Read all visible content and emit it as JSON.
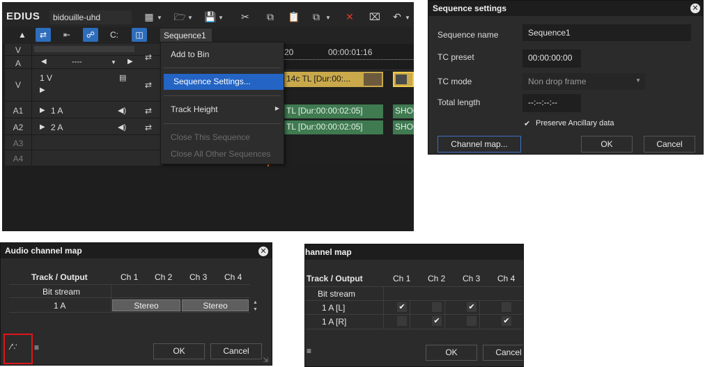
{
  "edius": {
    "logo": "EDIUS",
    "project_name": "bidouille-uhd",
    "sequence_tab": "Sequence1",
    "ruler": {
      "tc_left": "20",
      "tc_right": "00:00:01:16"
    },
    "tracks": {
      "v_label": "V",
      "a_label": "A",
      "a_value": "----",
      "v1_label": "V",
      "v1_name": "1 V",
      "a1_label": "A1",
      "a1_name": "1 A",
      "a2_label": "A2",
      "a2_name": "2 A",
      "a3_label": "A3",
      "a4_label": "A4"
    },
    "clips": {
      "video": "14c  TL [Dur:00:...",
      "a1": "TL [Dur:00:00:02:05]",
      "a2": "TL [Dur:00:00:02:05]",
      "shoot1": "SHOO",
      "shoot2": "SHOO"
    },
    "menu": {
      "add_to_bin": "Add to Bin",
      "sequence_settings": "Sequence Settings...",
      "track_height": "Track Height",
      "close_this": "Close This Sequence",
      "close_all_other": "Close All Other Sequences"
    }
  },
  "sequence_dialog": {
    "title": "Sequence settings",
    "name_label": "Sequence name",
    "name_value": "Sequence1",
    "tc_preset_label": "TC preset",
    "tc_preset_value": "00:00:00:00",
    "tc_mode_label": "TC mode",
    "tc_mode_value": "Non drop frame",
    "total_length_label": "Total length",
    "total_length_value": "--:--:--:--",
    "preserve_label": "Preserve Ancillary data",
    "channel_map_button": "Channel map...",
    "ok": "OK",
    "cancel": "Cancel"
  },
  "audio_map_left": {
    "title": "Audio channel map",
    "header_track": "Track / Output",
    "channels": [
      "Ch 1",
      "Ch 2",
      "Ch 3",
      "Ch 4"
    ],
    "bitstream": "Bit stream",
    "row_name": "1 A",
    "stereo1": "Stereo",
    "stereo2": "Stereo",
    "ok": "OK",
    "cancel": "Cancel"
  },
  "audio_map_right": {
    "title": "hannel map",
    "header_track": "Track / Output",
    "channels": [
      "Ch 1",
      "Ch 2",
      "Ch 3",
      "Ch 4"
    ],
    "bitstream": "Bit stream",
    "row1": "1 A [L]",
    "row2": "1 A [R]",
    "row1_checks": [
      true,
      false,
      true,
      false
    ],
    "row2_checks": [
      false,
      true,
      false,
      true
    ],
    "ok": "OK",
    "cancel": "Cancel"
  },
  "colors": {
    "highlight": "#2364c4",
    "video_clip": "#c9a94a",
    "audio_clip": "#3f7a51",
    "playhead": "#e67a2a",
    "red_box": "#e0151b"
  }
}
